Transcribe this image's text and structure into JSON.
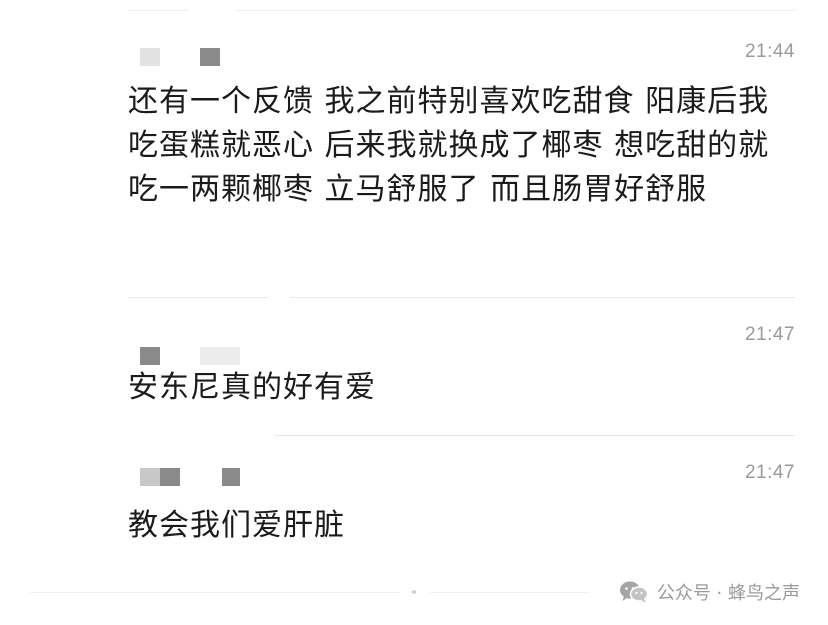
{
  "messages": [
    {
      "time": "21:44",
      "text": "还有一个反馈 我之前特别喜欢吃甜食 阳康后我吃蛋糕就恶心 后来我就换成了椰枣 想吃甜的就吃一两颗椰枣 立马舒服了 而且肠胃好舒服"
    },
    {
      "time": "21:47",
      "text": "安东尼真的好有爱"
    },
    {
      "time": "21:47",
      "text": "教会我们爱肝脏"
    }
  ],
  "watermark": {
    "text": "公众号 · 蜂鸟之声",
    "icon": "wechat-icon"
  },
  "colors": {
    "text": "#1b1b1b",
    "time": "#9a9a9a",
    "divider": "#e6e6e6",
    "name_mask_dark": "#8a8a8a",
    "name_mask_light": "#e2e2e2"
  }
}
